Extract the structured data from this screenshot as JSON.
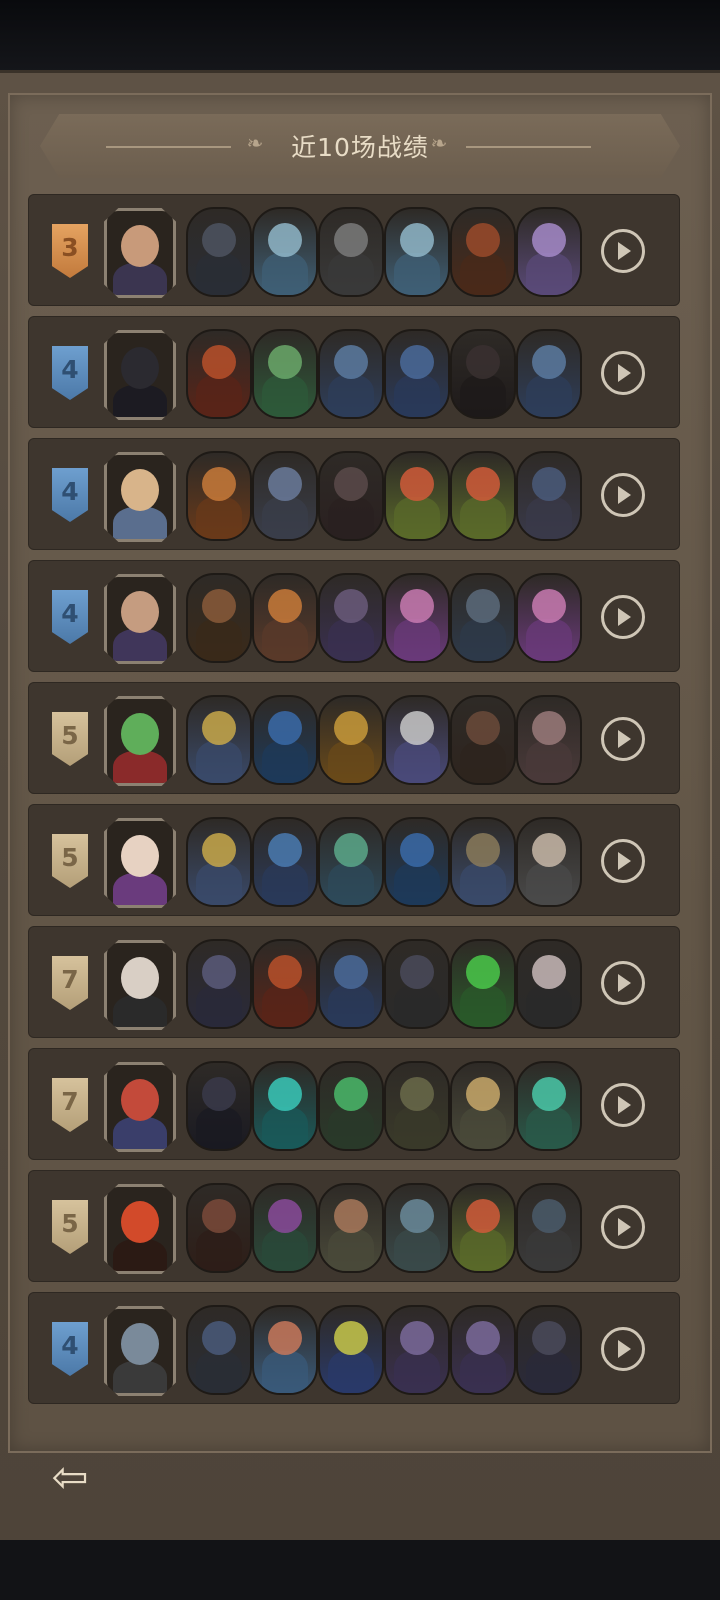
{
  "title": "近10场战绩",
  "back_icon": "back-arrow-icon",
  "play_icon": "play-icon",
  "colors": {
    "rank_blue": "#5b8cc0",
    "rank_orange": "#d08a48",
    "rank_tan": "#c7b28c"
  },
  "matches": [
    {
      "rank": "3",
      "rank_color": "orange"
    },
    {
      "rank": "4",
      "rank_color": "blue"
    },
    {
      "rank": "4",
      "rank_color": "blue"
    },
    {
      "rank": "4",
      "rank_color": "blue"
    },
    {
      "rank": "5",
      "rank_color": "tan"
    },
    {
      "rank": "5",
      "rank_color": "tan"
    },
    {
      "rank": "7",
      "rank_color": "tan"
    },
    {
      "rank": "7",
      "rank_color": "tan"
    },
    {
      "rank": "5",
      "rank_color": "tan"
    },
    {
      "rank": "4",
      "rank_color": "blue"
    }
  ]
}
